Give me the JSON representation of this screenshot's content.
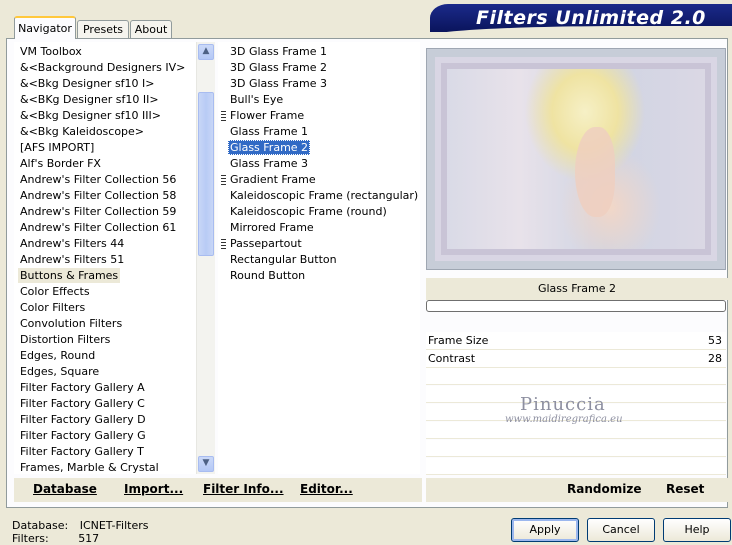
{
  "banner": {
    "title": "Filters Unlimited 2.0"
  },
  "tabs": [
    {
      "label": "Navigator"
    },
    {
      "label": "Presets"
    },
    {
      "label": "About"
    }
  ],
  "categories": {
    "items": [
      "VM Toolbox",
      "&<Background Designers IV>",
      "&<Bkg Designer sf10 I>",
      "&<BKg Designer sf10 II>",
      "&<Bkg Designer sf10 III>",
      "&<Bkg Kaleidoscope>",
      "[AFS IMPORT]",
      "Alf's Border FX",
      "Andrew's Filter Collection 56",
      "Andrew's Filter Collection 58",
      "Andrew's Filter Collection 59",
      "Andrew's Filter Collection 61",
      "Andrew's Filters 44",
      "Andrew's Filters 51",
      "Buttons & Frames",
      "Color Effects",
      "Color Filters",
      "Convolution Filters",
      "Distortion Filters",
      "Edges, Round",
      "Edges, Square",
      "Filter Factory Gallery A",
      "Filter Factory Gallery C",
      "Filter Factory Gallery D",
      "Filter Factory Gallery G",
      "Filter Factory Gallery T",
      "Frames, Marble & Crystal"
    ],
    "selected": "Buttons & Frames"
  },
  "filters": {
    "items": [
      "3D Glass Frame 1",
      "3D Glass Frame 2",
      "3D Glass Frame 3",
      "Bull's Eye",
      "Flower Frame",
      "Glass Frame 1",
      "Glass Frame 2",
      "Glass Frame 3",
      "Gradient Frame",
      "Kaleidoscopic Frame (rectangular)",
      "Kaleidoscopic Frame (round)",
      "Mirrored Frame",
      "Passepartout",
      "Rectangular Button",
      "Round Button"
    ],
    "selected": "Glass Frame 2"
  },
  "preview": {
    "filter_name": "Glass Frame 2",
    "progress": 0
  },
  "params": [
    {
      "label": "Frame Size",
      "value": "53"
    },
    {
      "label": "Contrast",
      "value": "28"
    }
  ],
  "watermark": {
    "line1": "Pinuccia",
    "line2": "www.maidiregrafica.eu"
  },
  "actions": {
    "database": "Database",
    "import": "Import...",
    "filter_info": "Filter Info...",
    "editor": "Editor...",
    "randomize": "Randomize",
    "reset": "Reset"
  },
  "status": {
    "database_label": "Database:",
    "database_value": "ICNET-Filters",
    "filters_label": "Filters:",
    "filters_value": "517"
  },
  "dialog": {
    "apply": "Apply",
    "cancel": "Cancel",
    "help": "Help"
  }
}
